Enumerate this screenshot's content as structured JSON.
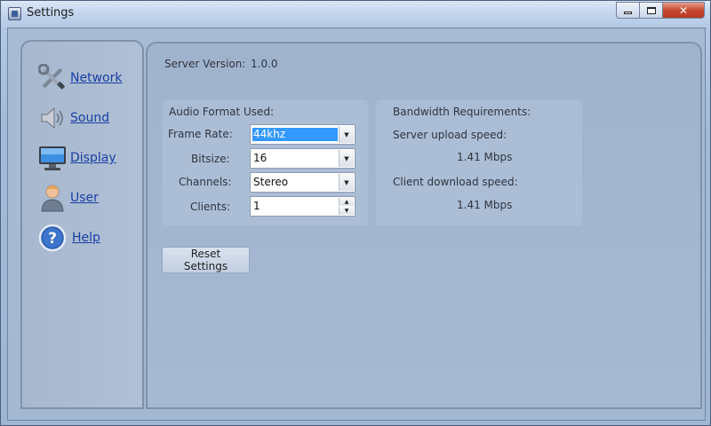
{
  "window": {
    "title": "Settings",
    "controls": {
      "minimize": "",
      "maximize": "",
      "close": "✕"
    }
  },
  "sidebar": {
    "items": [
      {
        "label": "Network",
        "icon": "wrench-icon"
      },
      {
        "label": "Sound",
        "icon": "speaker-icon"
      },
      {
        "label": "Display",
        "icon": "monitor-icon"
      },
      {
        "label": "User",
        "icon": "user-icon"
      },
      {
        "label": "Help",
        "icon": "help-icon"
      }
    ]
  },
  "server": {
    "version_label": "Server Version:",
    "version_value": "1.0.0"
  },
  "audio": {
    "title": "Audio Format Used:",
    "frame_rate_label": "Frame Rate:",
    "frame_rate_value": "44khz",
    "bitsize_label": "Bitsize:",
    "bitsize_value": "16",
    "channels_label": "Channels:",
    "channels_value": "Stereo",
    "clients_label": "Clients:",
    "clients_value": "1"
  },
  "bandwidth": {
    "title": "Bandwidth Requirements:",
    "upload_label": "Server upload speed:",
    "upload_value": "1.41 Mbps",
    "download_label": "Client download speed:",
    "download_value": "1.41 Mbps"
  },
  "actions": {
    "reset_label": "Reset Settings"
  },
  "colors": {
    "link": "#1a3fa3",
    "selection": "#3399ff",
    "close_button": "#c7472f"
  }
}
